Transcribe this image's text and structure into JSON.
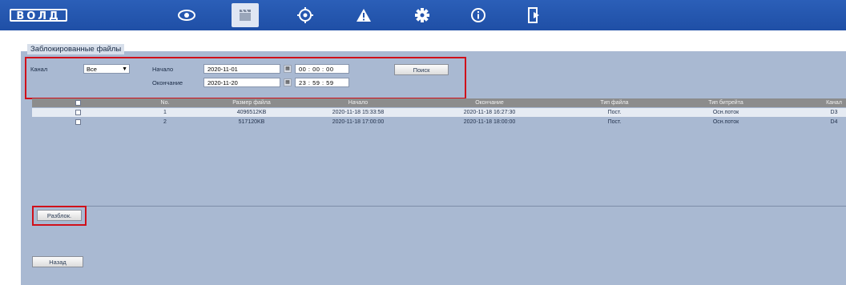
{
  "header": {
    "logo_text": "ВОЛД",
    "nav_icons": [
      "eye-icon",
      "film-clapper-icon",
      "crosshair-icon",
      "warning-icon",
      "gear-icon",
      "info-icon",
      "logout-icon"
    ]
  },
  "tab": {
    "label": "Заблокированные файлы"
  },
  "filters": {
    "channel_label": "Канал",
    "channel_value": "Все",
    "start_label": "Начало",
    "start_date": "2020-11-01",
    "start_time": "00 : 00 : 00",
    "end_label": "Окончание",
    "end_date": "2020-11-20",
    "end_time": "23 : 59 : 59",
    "search_label": "Поиск"
  },
  "table": {
    "headers": [
      "No.",
      "Размер файла",
      "Начало",
      "Окончание",
      "Тип файла",
      "Тип битрейта",
      "Канал"
    ],
    "rows": [
      [
        "1",
        "4096512KB",
        "2020-11-18 15:33:58",
        "2020-11-18 16:27:30",
        "Пост.",
        "Осн.поток",
        "D3"
      ],
      [
        "2",
        "517120KB",
        "2020-11-18 17:00:00",
        "2020-11-18 18:00:00",
        "Пост.",
        "Осн.поток",
        "D4"
      ]
    ]
  },
  "actions": {
    "unlock_label": "Разблок.",
    "back_label": "Назад"
  },
  "colors": {
    "highlight_border": "#d0101a",
    "header_blue": "#2b5fb8",
    "panel_bg": "#a9b9d2"
  }
}
